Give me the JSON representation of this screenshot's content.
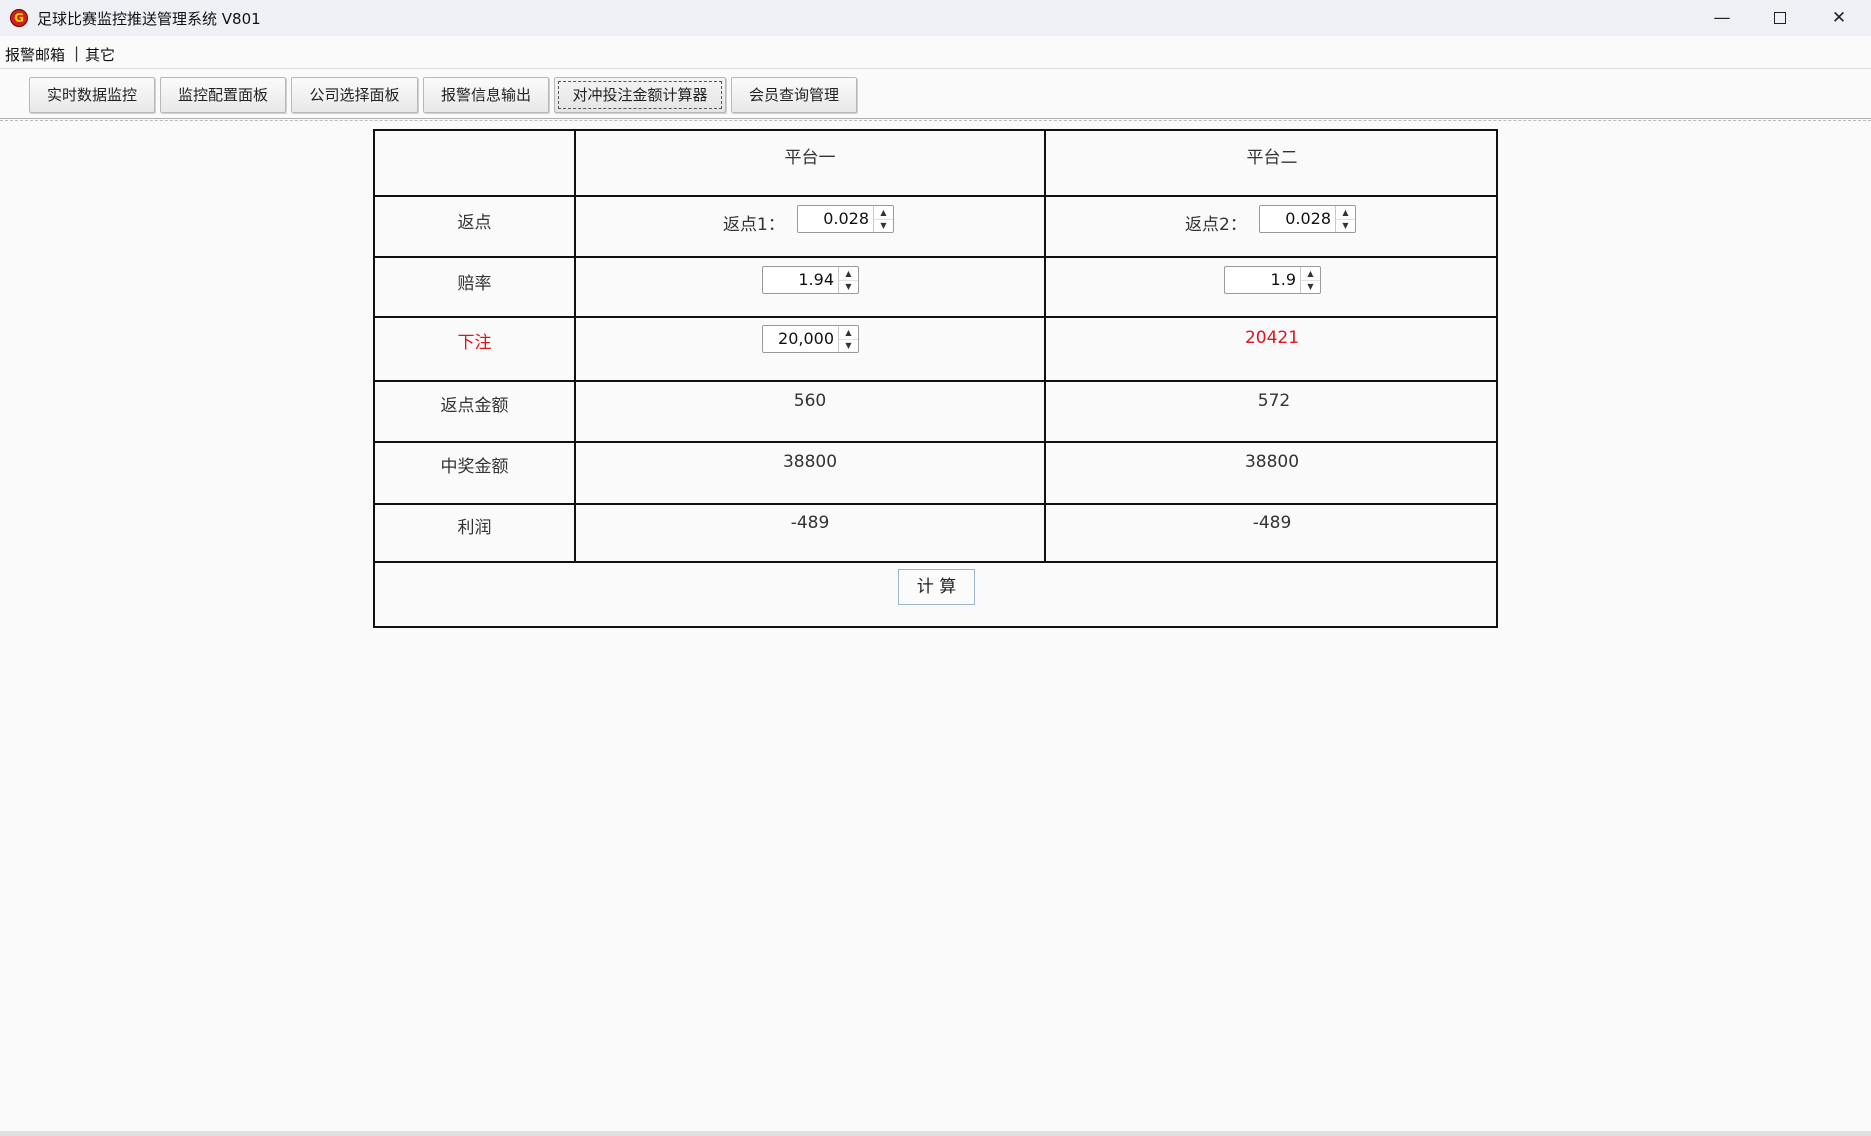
{
  "window": {
    "title": "足球比赛监控推送管理系统 V801",
    "icon": "app-ball-icon",
    "controls": {
      "minimize": "—",
      "close": "✕"
    }
  },
  "menu": {
    "items": [
      "报警邮箱",
      "其它"
    ],
    "separator": "|"
  },
  "tabs": [
    {
      "label": "实时数据监控",
      "active": false
    },
    {
      "label": "监控配置面板",
      "active": false
    },
    {
      "label": "公司选择面板",
      "active": false
    },
    {
      "label": "报警信息输出",
      "active": false
    },
    {
      "label": "对冲投注金额计算器",
      "active": true
    },
    {
      "label": "会员查询管理",
      "active": false
    }
  ],
  "calculator": {
    "headers": {
      "platform1": "平台一",
      "platform2": "平台二"
    },
    "rows": {
      "rebate": {
        "label": "返点",
        "p1_label": "返点1：",
        "p1_value": "0.028",
        "p2_label": "返点2：",
        "p2_value": "0.028"
      },
      "odds": {
        "label": "赔率",
        "p1_value": "1.94",
        "p2_value": "1.9"
      },
      "bet": {
        "label": "下注",
        "p1_value": "20,000",
        "p2_value": "20421"
      },
      "rebate_amount": {
        "label": "返点金额",
        "p1_value": "560",
        "p2_value": "572"
      },
      "win_amount": {
        "label": "中奖金额",
        "p1_value": "38800",
        "p2_value": "38800"
      },
      "profit": {
        "label": "利润",
        "p1_value": "-489",
        "p2_value": "-489"
      }
    },
    "calculate_button": "计 算",
    "colors": {
      "highlight": "#e0141b",
      "border": "#111111"
    }
  }
}
